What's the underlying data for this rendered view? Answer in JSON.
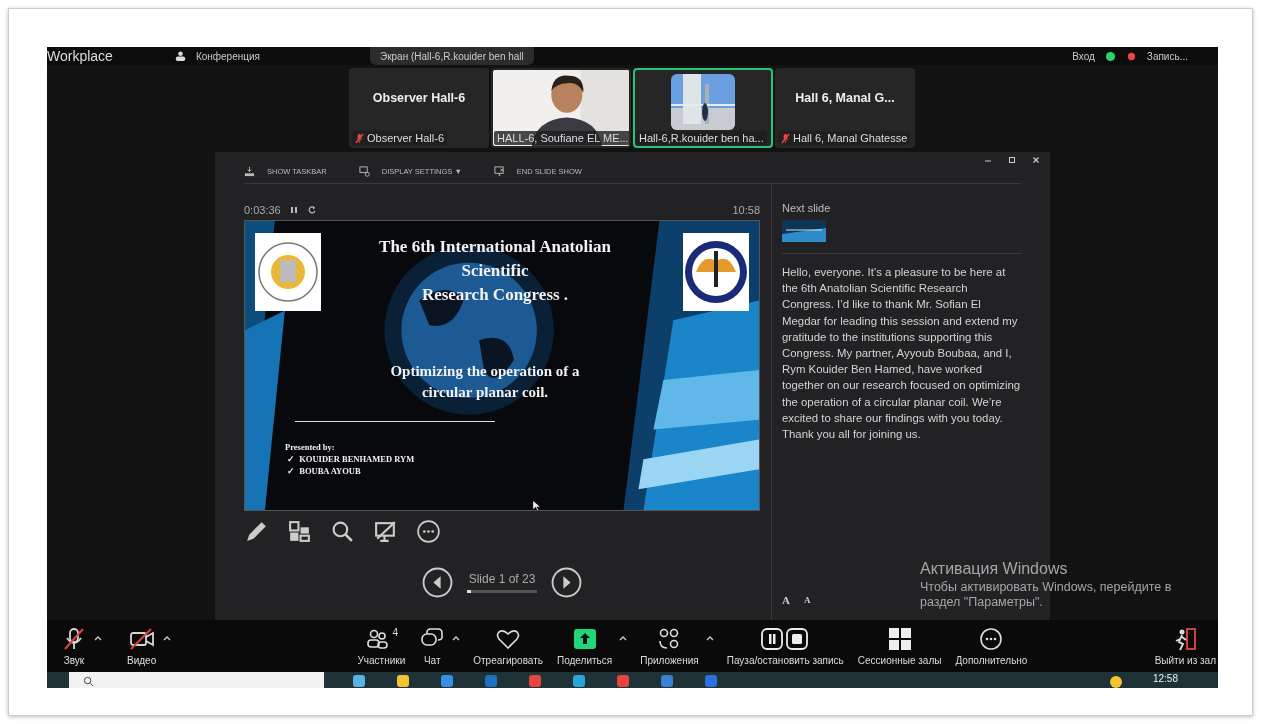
{
  "top_bar": {
    "app": "Workplace",
    "meeting": "Конференция",
    "share_pill": "Экран (Hall-6,R.kouider ben hall",
    "signin": "Вход",
    "recording": "Запись..."
  },
  "tiles": [
    {
      "kind": "name",
      "title": "Observer Hall-6",
      "label": "Observer Hall-6",
      "muted": true,
      "active": false
    },
    {
      "kind": "person",
      "label": "HALL-6, Soufiane EL ME...",
      "muted": false,
      "active": false
    },
    {
      "kind": "scene",
      "label": "Hall-6,R.kouider ben ha...",
      "muted": false,
      "active": true
    },
    {
      "kind": "name",
      "title": "Hall 6, Manal G...",
      "label": "Hall 6, Manal Ghatesse",
      "muted": true,
      "active": false
    }
  ],
  "presenter": {
    "toolbar": [
      {
        "kind": "taskbar",
        "label": "SHOW TASKBAR"
      },
      {
        "kind": "display",
        "label": "DISPLAY SETTINGS ▼"
      },
      {
        "kind": "end",
        "label": "END SLIDE SHOW"
      }
    ],
    "timer": "0:03:36",
    "clock": "10:58",
    "slide": {
      "title": [
        "The 6th International Anatolian",
        "Scientific",
        "Research Congress ."
      ],
      "subtitle": [
        "Optimizing the operation of a",
        "circular planar coil."
      ],
      "presented_by": "Presented by:",
      "authors": [
        {
          "mark": "✓",
          "name": "KOUIDER BENHAMED RYM"
        },
        {
          "mark": "✓",
          "name": "BOUBA AYOUB"
        }
      ]
    },
    "tools": [
      {
        "kind": "pen"
      },
      {
        "kind": "slides"
      },
      {
        "kind": "zoom"
      },
      {
        "kind": "screen"
      },
      {
        "kind": "more"
      }
    ],
    "counter": "Slide 1 of 23",
    "level": 0.05,
    "next_slide": "Next slide",
    "notes": "Hello, everyone. It’s a pleasure to be here at the 6th Anatolian Scientific Research Congress. I’d like to thank Mr. Sofian El Megdar for leading this session and extend my gratitude to the institutions supporting this Congress. My partner, Ayyoub Boubaa, and I, Rym Kouider Ben Hamed, have worked together on our research focused on optimizing the operation of a circular planar coil. We’re excited to share our findings with you today. Thank you all for joining us.",
    "font_buttons": [
      "A",
      "A"
    ]
  },
  "watermark": {
    "title": "Активация Windows",
    "text": "Чтобы активировать Windows, перейдите в раздел \"Параметры\"."
  },
  "controls": [
    {
      "kind": "mic",
      "label": "Звук",
      "off": true,
      "menu": true
    },
    {
      "kind": "camera",
      "label": "Видео",
      "off": true,
      "menu": true
    },
    {
      "kind": "people",
      "label": "Участники",
      "count": "4",
      "off": false,
      "menu": false
    },
    {
      "kind": "chat",
      "label": "Чат",
      "off": false,
      "menu": true
    },
    {
      "kind": "heart",
      "label": "Отреагировать",
      "off": false,
      "menu": false
    },
    {
      "kind": "share",
      "label": "Поделиться",
      "off": false,
      "menu": true
    },
    {
      "kind": "apps",
      "label": "Приложения",
      "off": false,
      "menu": true
    },
    {
      "kind": "record",
      "label": "Пауза/остановить запись",
      "off": false,
      "menu": false
    },
    {
      "kind": "rooms",
      "label": "Сессионные залы",
      "off": false,
      "menu": false
    },
    {
      "kind": "more",
      "label": "Дополнительно",
      "off": false,
      "menu": false
    },
    {
      "kind": "leave",
      "label": "Выйти из зал",
      "off": false,
      "menu": false
    }
  ],
  "taskbar": {
    "clock": "12:58"
  }
}
